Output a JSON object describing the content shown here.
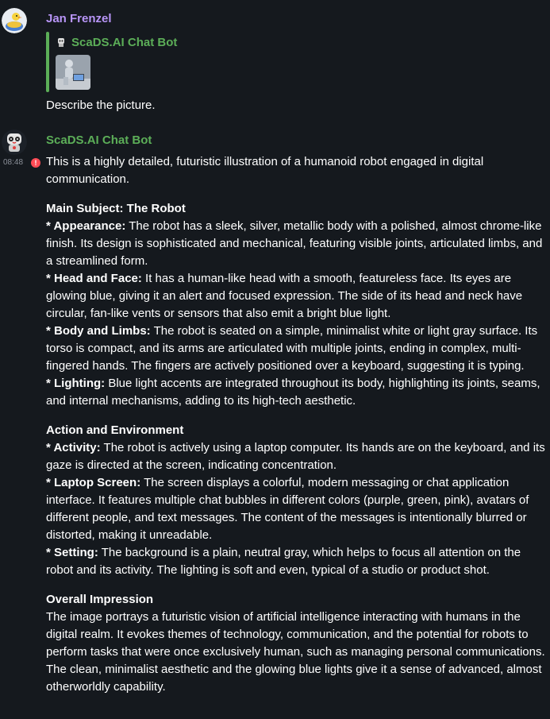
{
  "message1": {
    "sender": "Jan Frenzel",
    "sender_color": "#b895f7",
    "reply": {
      "sender": "ScaDS.AI Chat Bot",
      "sender_color": "#5cae58"
    },
    "text": "Describe the picture."
  },
  "message2": {
    "sender": "ScaDS.AI Chat Bot",
    "sender_color": "#5cae58",
    "time": "08:48",
    "status": "!",
    "intro": "This is a highly detailed, futuristic illustration of a humanoid robot engaged in digital communication.",
    "sections": [
      {
        "title": "Main Subject: The Robot",
        "items": [
          {
            "label": "* Appearance:",
            "text": " The robot has a sleek, silver, metallic body with a polished, almost chrome-like finish. Its design is sophisticated and mechanical, featuring visible joints, articulated limbs, and a streamlined form."
          },
          {
            "label": "* Head and Face:",
            "text": " It has a human-like head with a smooth, featureless face. Its eyes are glowing blue, giving it an alert and focused expression. The side of its head and neck have circular, fan-like vents or sensors that also emit a bright blue light."
          },
          {
            "label": "* Body and Limbs:",
            "text": " The robot is seated on a simple, minimalist white or light gray surface. Its torso is compact, and its arms are articulated with multiple joints, ending in complex, multi-fingered hands. The fingers are actively positioned over a keyboard, suggesting it is typing."
          },
          {
            "label": "* Lighting:",
            "text": " Blue light accents are integrated throughout its body, highlighting its joints, seams, and internal mechanisms, adding to its high-tech aesthetic."
          }
        ]
      },
      {
        "title": "Action and Environment",
        "items": [
          {
            "label": "* Activity:",
            "text": " The robot is actively using a laptop computer. Its hands are on the keyboard, and its gaze is directed at the screen, indicating concentration."
          },
          {
            "label": "* Laptop Screen:",
            "text": " The screen displays a colorful, modern messaging or chat application interface. It features multiple chat bubbles in different colors (purple, green, pink), avatars of different people, and text messages. The content of the messages is intentionally blurred or distorted, making it unreadable."
          },
          {
            "label": "* Setting:",
            "text": " The background is a plain, neutral gray, which helps to focus all attention on the robot and its activity. The lighting is soft and even, typical of a studio or product shot."
          }
        ]
      }
    ],
    "closing": {
      "title": "Overall Impression",
      "text": "The image portrays a futuristic vision of artificial intelligence interacting with humans in the digital realm. It evokes themes of technology, communication, and the potential for robots to perform tasks that were once exclusively human, such as managing personal communications. The clean, minimalist aesthetic and the glowing blue lights give it a sense of advanced, almost otherworldly capability."
    }
  }
}
